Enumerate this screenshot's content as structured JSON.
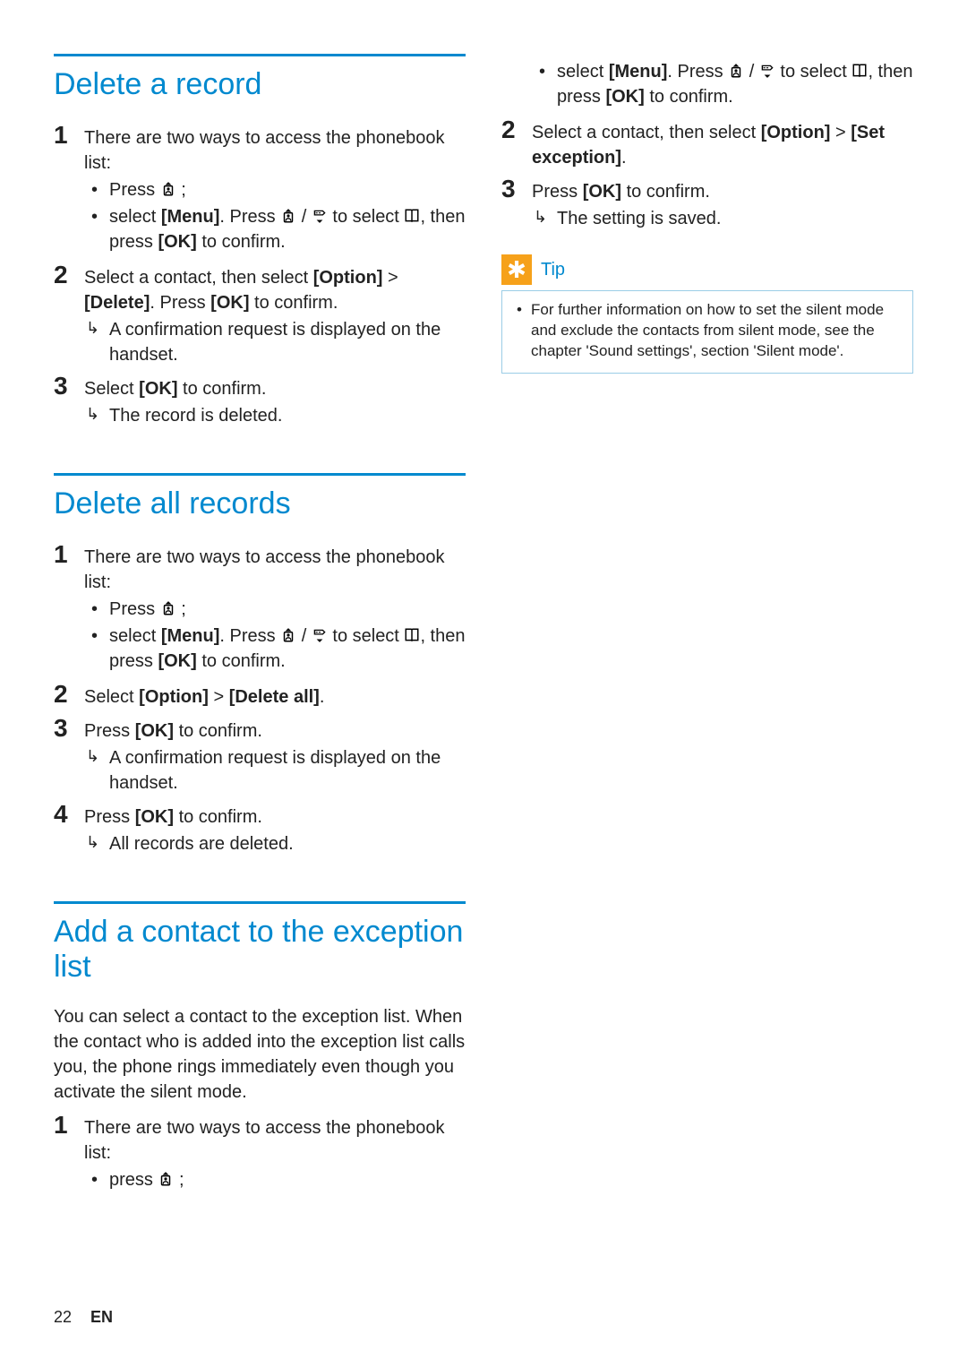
{
  "colors": {
    "accent": "#0089cf",
    "tip_bg": "#f6a11a"
  },
  "icons": {
    "phonebook": "📖",
    "up_contact": "⬆︎",
    "down_redial": "⬇︎"
  },
  "sections": {
    "delete_record": {
      "title": "Delete a record",
      "step1": {
        "intro": "There are two ways to access the phonebook list:",
        "b1_pre": "Press ",
        "b1_post": " ;",
        "b2_pre": "select ",
        "b2_menu": "[Menu]",
        "b2_mid1": ". Press ",
        "b2_mid2": " / ",
        "b2_mid3": " to select ",
        "b2_mid4": ", then press ",
        "b2_ok": "[OK]",
        "b2_end": " to confirm."
      },
      "step2": {
        "pre": "Select a contact, then select ",
        "opt": "[Option]",
        "gt": " > ",
        "del": "[Delete]",
        "mid": ". Press ",
        "ok": "[OK]",
        "end": " to confirm.",
        "result": "A confirmation request is displayed on the handset."
      },
      "step3": {
        "pre": "Select ",
        "ok": "[OK]",
        "end": " to confirm.",
        "result": "The record is deleted."
      }
    },
    "delete_all": {
      "title": "Delete all records",
      "step1": {
        "intro": "There are two ways to access the phonebook list:",
        "b1_pre": "Press ",
        "b1_post": " ;",
        "b2_pre": "select ",
        "b2_menu": "[Menu]",
        "b2_mid1": ". Press ",
        "b2_mid2": " / ",
        "b2_mid3": " to select ",
        "b2_mid4": ", then press ",
        "b2_ok": "[OK]",
        "b2_end": " to confirm."
      },
      "step2": {
        "pre": "Select ",
        "opt": "[Option]",
        "gt": " > ",
        "del": "[Delete all]",
        "end": "."
      },
      "step3": {
        "pre": "Press ",
        "ok": "[OK]",
        "end": " to confirm.",
        "result": "A confirmation request is displayed on the handset."
      },
      "step4": {
        "pre": "Press ",
        "ok": "[OK]",
        "end": " to confirm.",
        "result": "All records are deleted."
      }
    },
    "exception": {
      "title": "Add a contact to the exception list",
      "intro": "You can select a contact to the exception list. When the contact who is added into the exception list calls you, the phone rings immediately even though you activate the silent mode.",
      "step1": {
        "intro": "There are two ways to access the phonebook list:",
        "b1_pre": "press ",
        "b1_post": " ;"
      }
    },
    "right": {
      "cont_b2_pre": "select ",
      "cont_b2_menu": "[Menu]",
      "cont_b2_mid1": ". Press ",
      "cont_b2_mid2": " / ",
      "cont_b2_mid3": " to select ",
      "cont_b2_mid4": ", then press ",
      "cont_b2_ok": "[OK]",
      "cont_b2_end": " to confirm.",
      "step2": {
        "pre": "Select a contact, then select ",
        "opt": "[Option]",
        "gt": " > ",
        "set": "[Set exception]",
        "end": "."
      },
      "step3": {
        "pre": "Press ",
        "ok": "[OK]",
        "end": " to confirm.",
        "result": "The setting is saved."
      }
    }
  },
  "tip": {
    "label": "Tip",
    "text": "For further information on how to set the silent mode and exclude the contacts from silent mode, see the chapter 'Sound settings', section 'Silent mode'."
  },
  "footer": {
    "page": "22",
    "lang": "EN"
  },
  "nums": {
    "n1": "1",
    "n2": "2",
    "n3": "3",
    "n4": "4"
  }
}
